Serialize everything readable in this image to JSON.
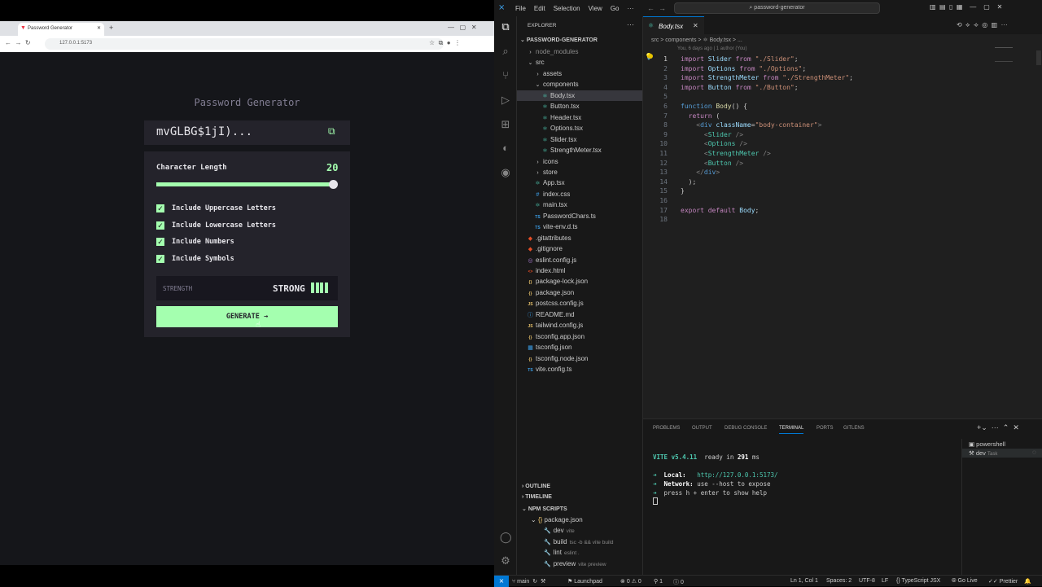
{
  "browser": {
    "tab_title": "Password Generator",
    "url": "127.0.0.1:5173"
  },
  "app": {
    "title": "Password Generator",
    "password": "mvGLBG$1jI)...",
    "char_length_label": "Character Length",
    "char_length_value": "20",
    "slider_fraction": 1.0,
    "options": [
      {
        "label": "Include Uppercase Letters"
      },
      {
        "label": "Include Lowercase Letters"
      },
      {
        "label": "Include Numbers"
      },
      {
        "label": "Include Symbols"
      }
    ],
    "strength_label": "STRENGTH",
    "strength_value": "STRONG",
    "strength_bars": 4,
    "generate_label": "GENERATE →"
  },
  "vscode": {
    "menu": [
      "File",
      "Edit",
      "Selection",
      "View",
      "Go",
      "···"
    ],
    "search": "password-generator",
    "explorer_title": "EXPLORER",
    "root": "PASSWORD-GENERATOR",
    "tree": [
      {
        "label": "node_modules",
        "icon": "›",
        "depth": 0,
        "dim": true
      },
      {
        "label": "src",
        "icon": "⌄",
        "depth": 0
      },
      {
        "label": "assets",
        "icon": "›",
        "depth": 1
      },
      {
        "label": "components",
        "icon": "⌄",
        "depth": 1
      },
      {
        "label": "Body.tsx",
        "icon": "⚛",
        "depth": 2,
        "selected": true
      },
      {
        "label": "Button.tsx",
        "icon": "⚛",
        "depth": 2
      },
      {
        "label": "Header.tsx",
        "icon": "⚛",
        "depth": 2
      },
      {
        "label": "Options.tsx",
        "icon": "⚛",
        "depth": 2
      },
      {
        "label": "Slider.tsx",
        "icon": "⚛",
        "depth": 2
      },
      {
        "label": "StrengthMeter.tsx",
        "icon": "⚛",
        "depth": 2
      },
      {
        "label": "icons",
        "icon": "›",
        "depth": 1
      },
      {
        "label": "store",
        "icon": "›",
        "depth": 1
      },
      {
        "label": "App.tsx",
        "icon": "⚛",
        "depth": 1
      },
      {
        "label": "index.css",
        "icon": "#",
        "depth": 1
      },
      {
        "label": "main.tsx",
        "icon": "⚛",
        "depth": 1
      },
      {
        "label": "PasswordChars.ts",
        "icon": "TS",
        "depth": 1
      },
      {
        "label": "vite-env.d.ts",
        "icon": "TS",
        "depth": 1
      },
      {
        "label": ".gitattributes",
        "icon": "◆",
        "depth": 0
      },
      {
        "label": ".gitignore",
        "icon": "◆",
        "depth": 0
      },
      {
        "label": "eslint.config.js",
        "icon": "◎",
        "depth": 0
      },
      {
        "label": "index.html",
        "icon": "<>",
        "depth": 0
      },
      {
        "label": "package-lock.json",
        "icon": "{}",
        "depth": 0
      },
      {
        "label": "package.json",
        "icon": "{}",
        "depth": 0
      },
      {
        "label": "postcss.config.js",
        "icon": "JS",
        "depth": 0
      },
      {
        "label": "README.md",
        "icon": "ⓘ",
        "depth": 0
      },
      {
        "label": "tailwind.config.js",
        "icon": "JS",
        "depth": 0
      },
      {
        "label": "tsconfig.app.json",
        "icon": "{}",
        "depth": 0
      },
      {
        "label": "tsconfig.json",
        "icon": "▦",
        "depth": 0
      },
      {
        "label": "tsconfig.node.json",
        "icon": "{}",
        "depth": 0
      },
      {
        "label": "vite.config.ts",
        "icon": "TS",
        "depth": 0
      }
    ],
    "outline": "OUTLINE",
    "timeline": "TIMELINE",
    "npm_scripts": "NPM SCRIPTS",
    "npm_pkg": "package.json",
    "scripts": [
      {
        "name": "dev",
        "cmd": "vite"
      },
      {
        "name": "build",
        "cmd": "tsc -b && vite build"
      },
      {
        "name": "lint",
        "cmd": "eslint ."
      },
      {
        "name": "preview",
        "cmd": "vite preview"
      }
    ],
    "editor_tab": "Body.tsx",
    "breadcrumb": "src > components > ⚛ Body.tsx > ...",
    "blame": "You, 6 days ago | 1 author (You)",
    "panel_tabs": [
      "PROBLEMS",
      "OUTPUT",
      "DEBUG CONSOLE",
      "TERMINAL",
      "PORTS",
      "GITLENS"
    ],
    "terminal": {
      "vite": "VITE v5.4.11",
      "ready": "ready in",
      "ms": "291",
      "ms_unit": "ms",
      "local_label": "Local:",
      "local_url": "http://127.0.0.1:5173/",
      "network_label": "Network:",
      "network_text": "use --host to expose",
      "help": "press h + enter to show help"
    },
    "term_list": [
      "powershell",
      "dev"
    ],
    "term_task": "Task",
    "status": {
      "branch": "main",
      "launchpad": "Launchpad",
      "errors": "0",
      "warnings": "0",
      "ports": "1",
      "info": "0",
      "position": "Ln 1, Col 1",
      "spaces": "Spaces: 2",
      "encoding": "UTF-8",
      "eol": "LF",
      "lang": "TypeScript JSX",
      "golive": "Go Live",
      "prettier": "Prettier"
    }
  }
}
